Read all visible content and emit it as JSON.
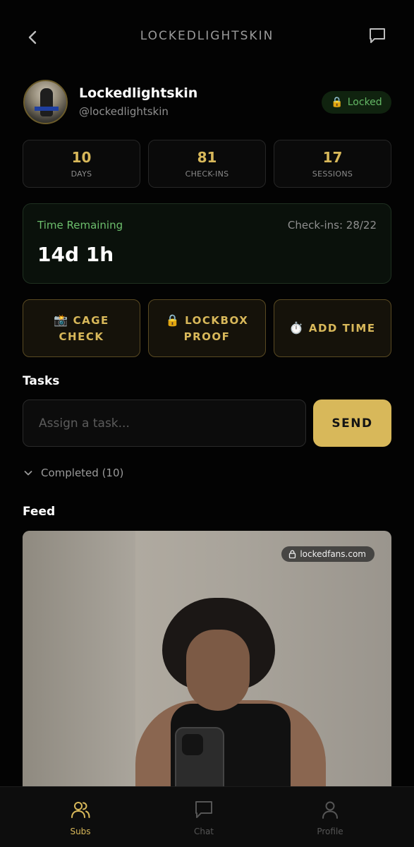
{
  "header": {
    "title": "LOCKEDLIGHTSKIN"
  },
  "profile": {
    "display_name": "Lockedlightskin",
    "handle": "@lockedlightskin",
    "status_badge": "Locked"
  },
  "stats": [
    {
      "value": "10",
      "label": "DAYS"
    },
    {
      "value": "81",
      "label": "CHECK-INS"
    },
    {
      "value": "17",
      "label": "SESSIONS"
    }
  ],
  "time_card": {
    "label": "Time Remaining",
    "checkins": "Check-ins: 28/22",
    "remaining": "14d 1h"
  },
  "actions": [
    {
      "emoji": "📸",
      "line1": "CAGE",
      "line2": "CHECK"
    },
    {
      "emoji": "🔒",
      "line1": "LOCKBOX",
      "line2": "PROOF"
    },
    {
      "emoji": "⏱️",
      "line1": "ADD TIME",
      "line2": ""
    }
  ],
  "tasks": {
    "title": "Tasks",
    "placeholder": "Assign a task...",
    "send_label": "SEND",
    "completed_label": "Completed (10)"
  },
  "feed": {
    "title": "Feed",
    "watermark": "lockedfans.com"
  },
  "nav": [
    {
      "label": "Subs",
      "icon": "users-icon",
      "active": true
    },
    {
      "label": "Chat",
      "icon": "chat-icon",
      "active": false
    },
    {
      "label": "Profile",
      "icon": "user-icon",
      "active": false
    }
  ],
  "colors": {
    "accent": "#d8b85a",
    "success": "#64b865",
    "background": "#030303"
  }
}
